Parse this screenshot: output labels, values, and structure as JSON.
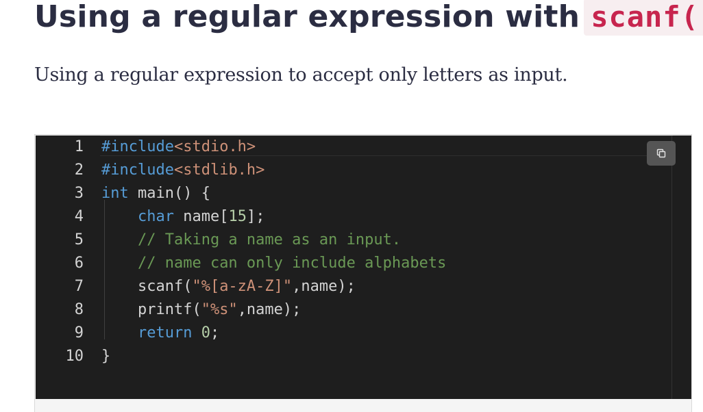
{
  "header": {
    "title": "Using a regular expression with",
    "title_code": "scanf()"
  },
  "description": "Using a regular expression to accept only letters as input.",
  "editor": {
    "line_numbers": [
      "1",
      "2",
      "3",
      "4",
      "5",
      "6",
      "7",
      "8",
      "9",
      "10"
    ],
    "lines": [
      [
        {
          "t": "kw",
          "v": "#include"
        },
        {
          "t": "inc",
          "v": "<stdio.h>"
        }
      ],
      [
        {
          "t": "kw",
          "v": "#include"
        },
        {
          "t": "inc",
          "v": "<stdlib.h>"
        }
      ],
      [
        {
          "t": "kw",
          "v": "int"
        },
        {
          "t": "plain",
          "v": " main() {"
        }
      ],
      [
        {
          "t": "plain",
          "v": "    "
        },
        {
          "t": "kw",
          "v": "char"
        },
        {
          "t": "plain",
          "v": " name["
        },
        {
          "t": "num",
          "v": "15"
        },
        {
          "t": "plain",
          "v": "];"
        }
      ],
      [
        {
          "t": "plain",
          "v": "    "
        },
        {
          "t": "cmt",
          "v": "// Taking a name as an input."
        }
      ],
      [
        {
          "t": "plain",
          "v": "    "
        },
        {
          "t": "cmt",
          "v": "// name can only include alphabets"
        }
      ],
      [
        {
          "t": "plain",
          "v": "    scanf("
        },
        {
          "t": "str",
          "v": "\"%[a-zA-Z]\""
        },
        {
          "t": "plain",
          "v": ",name);"
        }
      ],
      [
        {
          "t": "plain",
          "v": "    printf("
        },
        {
          "t": "str",
          "v": "\"%s\""
        },
        {
          "t": "plain",
          "v": ",name);"
        }
      ],
      [
        {
          "t": "plain",
          "v": "    "
        },
        {
          "t": "kw",
          "v": "return"
        },
        {
          "t": "plain",
          "v": " "
        },
        {
          "t": "num",
          "v": "0"
        },
        {
          "t": "plain",
          "v": ";"
        }
      ],
      [
        {
          "t": "plain",
          "v": "}"
        }
      ]
    ],
    "copy_icon": "copy-icon"
  }
}
